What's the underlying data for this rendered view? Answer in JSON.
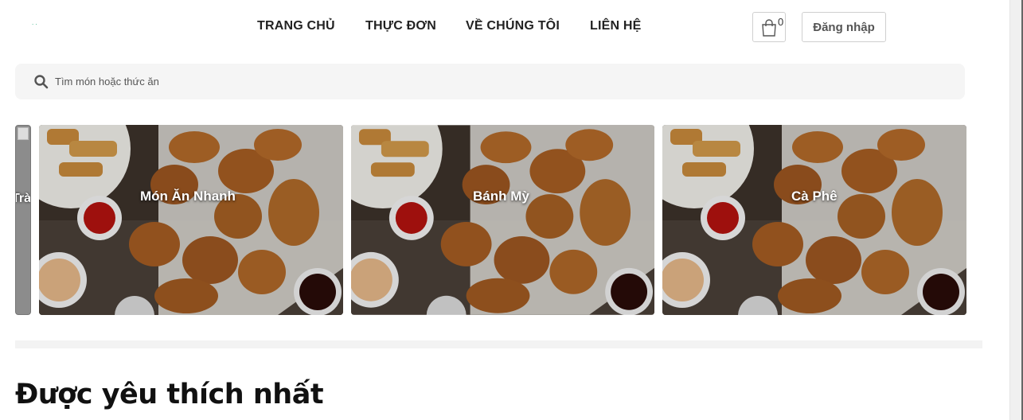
{
  "logo": {
    "text": ".."
  },
  "nav": {
    "items": [
      {
        "label": "TRANG CHỦ"
      },
      {
        "label": "THỰC ĐƠN"
      },
      {
        "label": "VỀ CHÚNG TÔI"
      },
      {
        "label": "LIÊN HỆ"
      }
    ]
  },
  "header": {
    "cart_icon": "shopping-bag-icon",
    "cart_count": "0",
    "login_label": "Đăng nhập"
  },
  "search": {
    "icon": "search-icon",
    "placeholder": "Tìm món hoặc thức ăn",
    "value": ""
  },
  "categories": [
    {
      "label": "Trà Sữa",
      "image": "broken-image-icon"
    },
    {
      "label": "Món Ăn Nhanh",
      "image": "fried-chicken-photo"
    },
    {
      "label": "Bánh Mỳ",
      "image": "fried-chicken-photo"
    },
    {
      "label": "Cà Phê",
      "image": "fried-chicken-photo"
    }
  ],
  "sections": {
    "favorites_title": "Được yêu thích nhất"
  },
  "colors": {
    "text_dark": "#222222",
    "search_bg": "#f5f5f5",
    "card_overlay_text": "#ffffff"
  }
}
